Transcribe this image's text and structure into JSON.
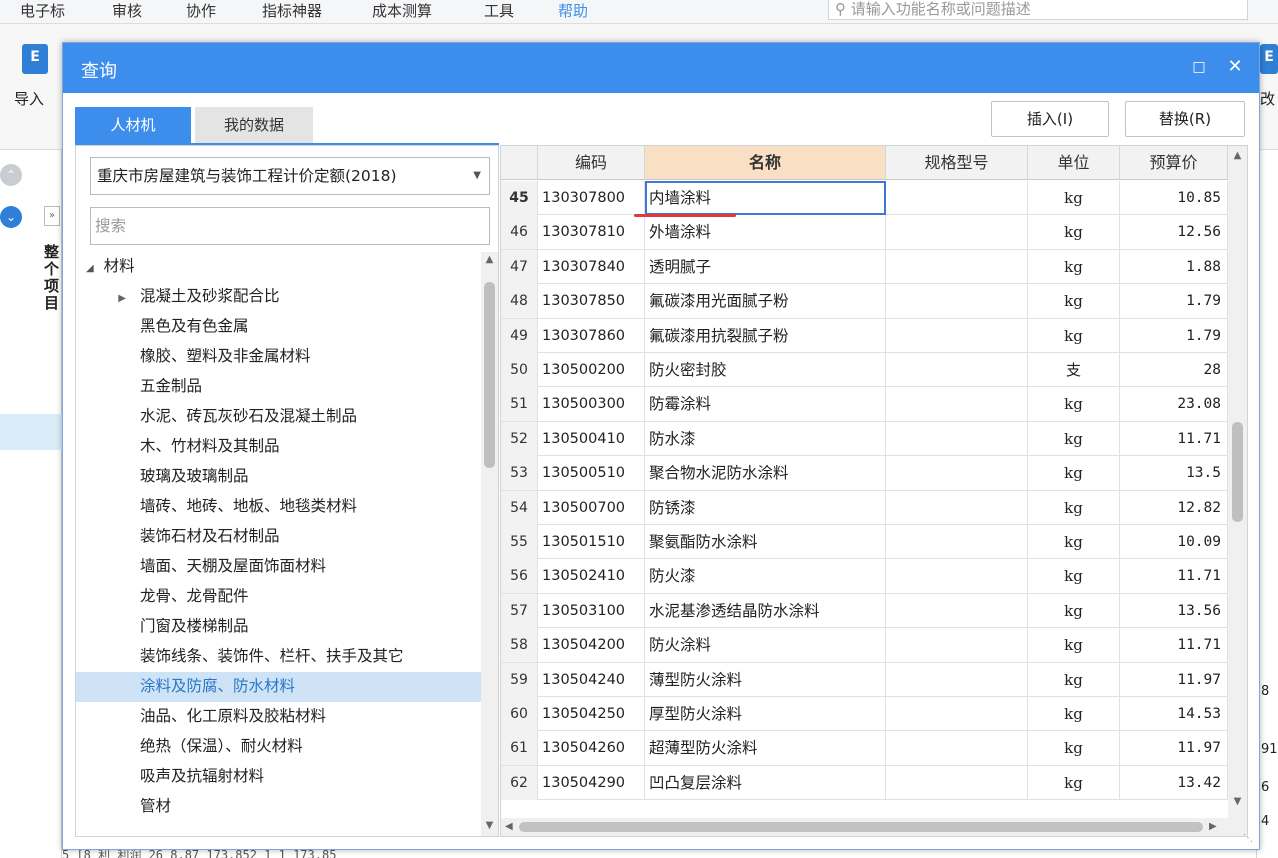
{
  "menu": {
    "items": [
      "电子标",
      "审核",
      "协作",
      "指标神器",
      "成本测算",
      "工具",
      "帮助"
    ],
    "search_placeholder": "请输入功能名称或问题描述"
  },
  "ribbon": {
    "import_label": "导入",
    "left_vertical_label": "整个项目",
    "right_label": "改"
  },
  "dialog": {
    "title": "查询",
    "tabs": [
      {
        "label": "人材机",
        "active": true
      },
      {
        "label": "我的数据",
        "active": false
      }
    ],
    "insert_button": "插入(I)",
    "replace_button": "替换(R)",
    "quota_select": "重庆市房屋建筑与装饰工程计价定额(2018)",
    "search_placeholder": "搜索",
    "tree": {
      "root": "材料",
      "items": [
        {
          "label": "混凝土及砂浆配合比",
          "expandable": true
        },
        {
          "label": "黑色及有色金属"
        },
        {
          "label": "橡胶、塑料及非金属材料"
        },
        {
          "label": "五金制品"
        },
        {
          "label": "水泥、砖瓦灰砂石及混凝土制品"
        },
        {
          "label": "木、竹材料及其制品"
        },
        {
          "label": "玻璃及玻璃制品"
        },
        {
          "label": "墙砖、地砖、地板、地毯类材料"
        },
        {
          "label": "装饰石材及石材制品"
        },
        {
          "label": "墙面、天棚及屋面饰面材料"
        },
        {
          "label": "龙骨、龙骨配件"
        },
        {
          "label": "门窗及楼梯制品"
        },
        {
          "label": "装饰线条、装饰件、栏杆、扶手及其它"
        },
        {
          "label": "涂料及防腐、防水材料",
          "selected": true
        },
        {
          "label": "油品、化工原料及胶粘材料"
        },
        {
          "label": "绝热（保温）、耐火材料"
        },
        {
          "label": "吸声及抗辐射材料"
        },
        {
          "label": "管材"
        }
      ]
    },
    "table": {
      "columns": [
        "",
        "编码",
        "名称",
        "规格型号",
        "单位",
        "预算价"
      ],
      "rows": [
        {
          "num": "45",
          "code": "130307800",
          "name": "内墙涂料",
          "spec": "",
          "unit": "kg",
          "price": "10.85"
        },
        {
          "num": "46",
          "code": "130307810",
          "name": "外墙涂料",
          "spec": "",
          "unit": "kg",
          "price": "12.56"
        },
        {
          "num": "47",
          "code": "130307840",
          "name": "透明腻子",
          "spec": "",
          "unit": "kg",
          "price": "1.88"
        },
        {
          "num": "48",
          "code": "130307850",
          "name": "氟碳漆用光面腻子粉",
          "spec": "",
          "unit": "kg",
          "price": "1.79"
        },
        {
          "num": "49",
          "code": "130307860",
          "name": "氟碳漆用抗裂腻子粉",
          "spec": "",
          "unit": "kg",
          "price": "1.79"
        },
        {
          "num": "50",
          "code": "130500200",
          "name": "防火密封胶",
          "spec": "",
          "unit": "支",
          "price": "28"
        },
        {
          "num": "51",
          "code": "130500300",
          "name": "防霉涂料",
          "spec": "",
          "unit": "kg",
          "price": "23.08"
        },
        {
          "num": "52",
          "code": "130500410",
          "name": "防水漆",
          "spec": "",
          "unit": "kg",
          "price": "11.71"
        },
        {
          "num": "53",
          "code": "130500510",
          "name": "聚合物水泥防水涂料",
          "spec": "",
          "unit": "kg",
          "price": "13.5"
        },
        {
          "num": "54",
          "code": "130500700",
          "name": "防锈漆",
          "spec": "",
          "unit": "kg",
          "price": "12.82"
        },
        {
          "num": "55",
          "code": "130501510",
          "name": "聚氨酯防水涂料",
          "spec": "",
          "unit": "kg",
          "price": "10.09"
        },
        {
          "num": "56",
          "code": "130502410",
          "name": "防火漆",
          "spec": "",
          "unit": "kg",
          "price": "11.71"
        },
        {
          "num": "57",
          "code": "130503100",
          "name": "水泥基渗透结晶防水涂料",
          "spec": "",
          "unit": "kg",
          "price": "13.56"
        },
        {
          "num": "58",
          "code": "130504200",
          "name": "防火涂料",
          "spec": "",
          "unit": "kg",
          "price": "11.71"
        },
        {
          "num": "59",
          "code": "130504240",
          "name": "薄型防火涂料",
          "spec": "",
          "unit": "kg",
          "price": "11.97"
        },
        {
          "num": "60",
          "code": "130504250",
          "name": "厚型防火涂料",
          "spec": "",
          "unit": "kg",
          "price": "14.53"
        },
        {
          "num": "61",
          "code": "130504260",
          "name": "超薄型防火涂料",
          "spec": "",
          "unit": "kg",
          "price": "11.97"
        },
        {
          "num": "62",
          "code": "130504290",
          "name": "凹凸复层涂料",
          "spec": "",
          "unit": "kg",
          "price": "13.42"
        }
      ]
    }
  },
  "background_bottom_row": "5  [8      利  利润                       26           8.87  173.852       1          1  173.85",
  "right_strip_values": [
    "8",
    "91",
    "6",
    "4"
  ],
  "colors": {
    "accent": "#3d8eec",
    "selected_header": "#f9e0c4",
    "tree_selected": "#cfe3f7",
    "underline": "#e03a3a"
  }
}
